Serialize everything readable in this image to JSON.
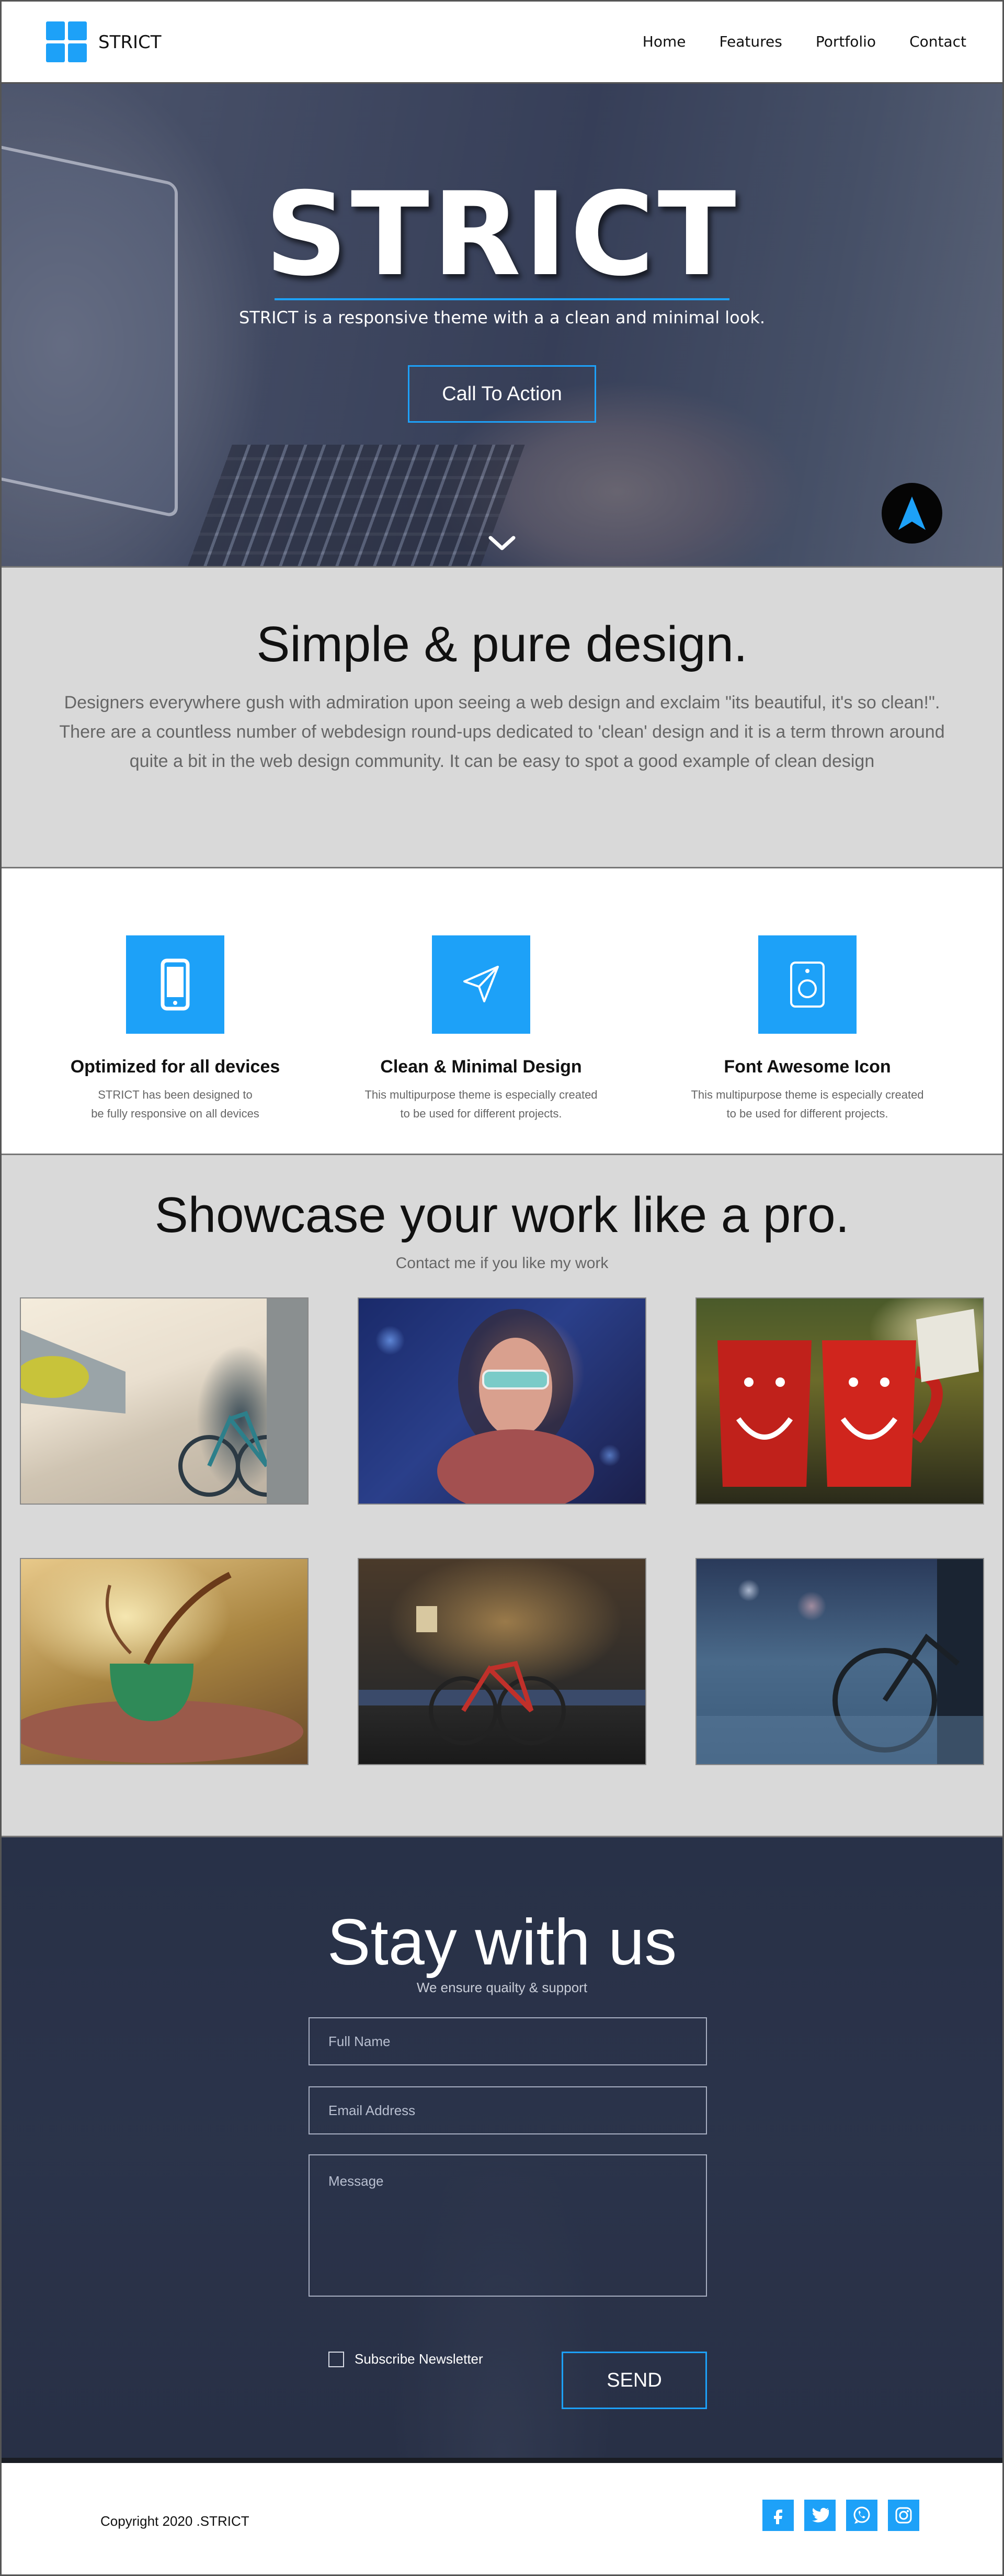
{
  "colors": {
    "accent": "#1da1f8",
    "section_gray": "#d9d9d9",
    "dark_overlay": "#252c42"
  },
  "nav": {
    "brand": "STRICT",
    "items": [
      {
        "label": "Home"
      },
      {
        "label": "Features"
      },
      {
        "label": "Portfolio"
      },
      {
        "label": "Contact"
      }
    ]
  },
  "hero": {
    "title": "STRICT",
    "tagline": "STRICT is a responsive theme with a a clean and minimal look.",
    "cta_label": "Call To Action",
    "scroll_icon": "chevron-down-icon",
    "fab_icon": "navigation-arrow-icon"
  },
  "intro": {
    "heading": "Simple & pure design.",
    "body": "Designers everywhere gush with admiration upon seeing a web design and exclaim \"its beautiful, it's so clean!\". There are a countless number of webdesign round-ups dedicated to 'clean' design and it is a term thrown around quite a bit in the web design community. It can be easy to spot a good example of clean design"
  },
  "features": [
    {
      "icon": "mobile-phone-icon",
      "title": "Optimized for all devices",
      "desc": "STRICT has been designed to\nbe fully responsive on all devices"
    },
    {
      "icon": "paper-plane-icon",
      "title": "Clean & Minimal Design",
      "desc": "This multipurpose theme is especially created\nto be used for different projects."
    },
    {
      "icon": "speaker-icon",
      "title": "Font Awesome Icon",
      "desc": "This multipurpose theme is especially created\nto be used for different projects."
    }
  ],
  "portfolio": {
    "heading": "Showcase your work like a pro.",
    "subheading": "Contact me if you like my work",
    "items": [
      {
        "subject": "bicycle-street-photo"
      },
      {
        "subject": "woman-sunglasses-photo"
      },
      {
        "subject": "red-smiley-mugs-photo"
      },
      {
        "subject": "splashing-cup-photo"
      },
      {
        "subject": "red-bicycle-photo"
      },
      {
        "subject": "bicycle-bokeh-photo"
      }
    ]
  },
  "contact": {
    "heading": "Stay with us",
    "subheading": "We ensure quailty & support",
    "name_placeholder": "Full Name",
    "email_placeholder": "Email Address",
    "message_placeholder": "Message",
    "newsletter_label": "Subscribe Newsletter",
    "send_label": "SEND"
  },
  "footer": {
    "copyright": "Copyright  2020 .STRICT",
    "social": [
      "facebook-icon",
      "twitter-icon",
      "whatsapp-icon",
      "instagram-icon"
    ]
  }
}
